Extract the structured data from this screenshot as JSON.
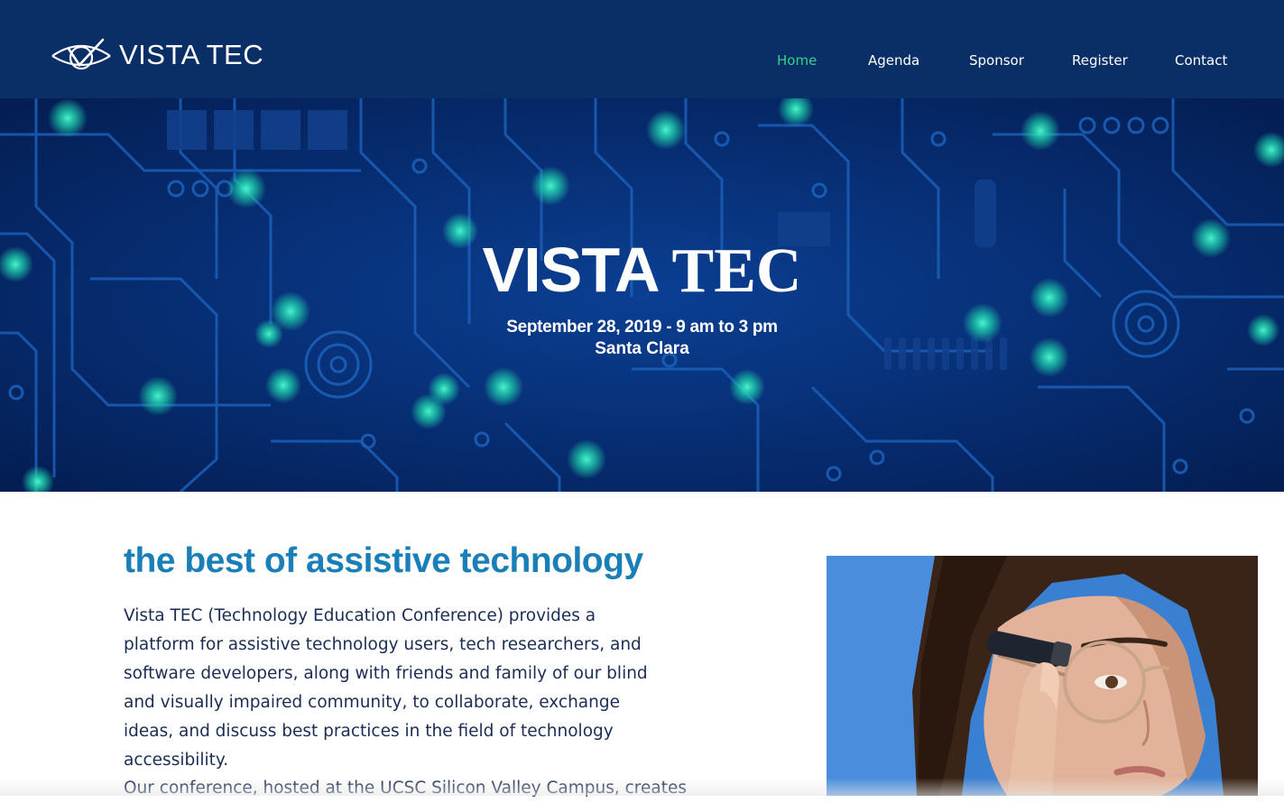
{
  "header": {
    "logo_text": "VISTA TEC",
    "nav": [
      {
        "label": "Home",
        "active": true
      },
      {
        "label": "Agenda",
        "active": false
      },
      {
        "label": "Sponsor",
        "active": false
      },
      {
        "label": "Register",
        "active": false
      },
      {
        "label": "Contact",
        "active": false
      }
    ]
  },
  "hero": {
    "title_part1": "VISTA",
    "title_part2": "TEC",
    "date_line": "September 28, 2019 - 9 am to 3 pm",
    "location_line": "Santa Clara"
  },
  "content": {
    "heading": "the best of assistive technology",
    "paragraph1": "Vista TEC (Technology Education Conference) provides a platform for assistive technology users, tech researchers, and software developers, along with friends and family of our blind and visually impaired community, to collaborate, exchange ideas, and discuss best practices in the field of technology accessibility.",
    "paragraph2": "Our conference, hosted at the UCSC Silicon Valley Campus, creates"
  },
  "colors": {
    "header_bg": "#0a2f66",
    "nav_active": "#34d08a",
    "heading": "#1a7fb8",
    "body_text": "#1b2d55"
  },
  "icons": {
    "logo_mark": "eye-check-logo-icon",
    "hero_photo": "woman-with-smart-glasses-device-photo"
  }
}
